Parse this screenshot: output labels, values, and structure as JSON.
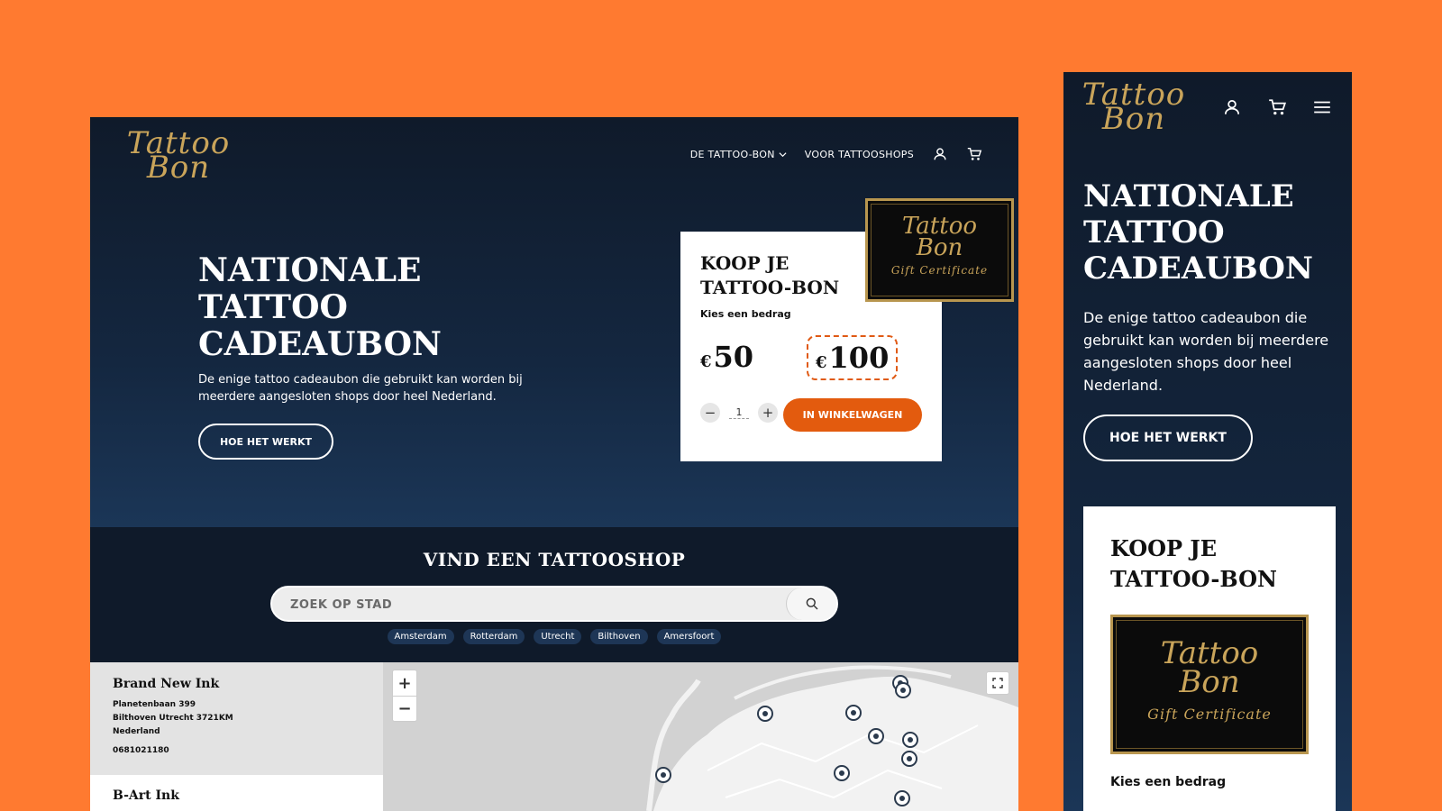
{
  "brand": {
    "logo_line1": "Tattoo",
    "logo_line2": "Bon"
  },
  "nav": {
    "item1": "DE TATTOO-BON",
    "item2": "VOOR TATTOOSHOPS"
  },
  "hero": {
    "title_lines": [
      "NATIONALE",
      "TATTOO",
      "CADEAUBON"
    ],
    "subtitle": "De enige tattoo cadeaubon die gebruikt kan worden bij meerdere aangesloten shops door heel Nederland.",
    "cta": "HOE HET WERKT"
  },
  "buy_card": {
    "title_lines": [
      "KOOP JE",
      "TATTOO-BON"
    ],
    "choose_label": "Kies een bedrag",
    "currency": "€",
    "amounts": [
      "50",
      "100"
    ],
    "selected_amount": "100",
    "quantity": "1",
    "minus": "−",
    "plus": "+",
    "add_to_cart": "IN WINKELWAGEN"
  },
  "certificate": {
    "line1": "Tattoo",
    "line2": "Bon",
    "line3": "Gift Certificate"
  },
  "finder": {
    "title": "VIND EEN TATTOOSHOP",
    "search_placeholder": "ZOEK OP STAD",
    "cities": [
      "Amsterdam",
      "Rotterdam",
      "Utrecht",
      "Bilthoven",
      "Amersfoort"
    ]
  },
  "shops": [
    {
      "name": "Brand New Ink",
      "street": "Planetenbaan 399",
      "city_line": "Bilthoven Utrecht 3721KM",
      "country": "Nederland",
      "phone": "0681021180"
    },
    {
      "name": "B-Art Ink"
    }
  ],
  "map": {
    "zoom_in": "+",
    "zoom_out": "−"
  },
  "colors": {
    "background": "#FF7A30",
    "navy": "#0f1a2a",
    "accent": "#E35B0E",
    "gold": "#c9a45a"
  }
}
